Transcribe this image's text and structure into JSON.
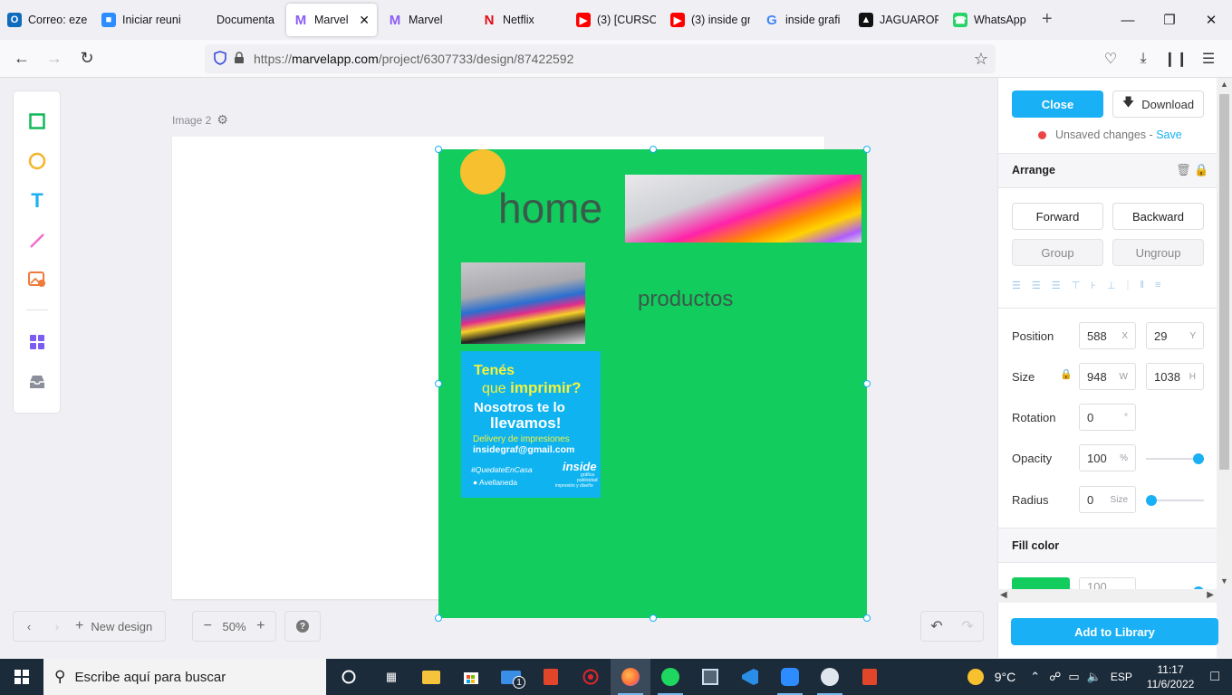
{
  "browser": {
    "tabs": [
      {
        "label": "Correo: eze",
        "icon": "outlook-icon",
        "color": "#0f6cbd"
      },
      {
        "label": "Iniciar reuni",
        "icon": "zoom-icon",
        "color": "#2d8cff"
      },
      {
        "label": "Documenta",
        "icon": "document-icon",
        "color": "#aaaaaa"
      },
      {
        "label": "Marvel",
        "icon": "marvel-icon",
        "color": "#8c5cf5",
        "active": true
      },
      {
        "label": "Marvel",
        "icon": "marvel-icon",
        "color": "#8c5cf5"
      },
      {
        "label": "Netflix",
        "icon": "netflix-icon",
        "color": "#e50914"
      },
      {
        "label": "(3) [CURSO",
        "icon": "youtube-icon",
        "color": "#ff0000"
      },
      {
        "label": "(3) inside gr",
        "icon": "youtube-icon",
        "color": "#ff0000"
      },
      {
        "label": "inside grafi",
        "icon": "google-icon",
        "color": "#4285f4"
      },
      {
        "label": "JAGUAROF",
        "icon": "jaguar-icon",
        "color": "#111111"
      },
      {
        "label": "WhatsApp",
        "icon": "whatsapp-icon",
        "color": "#25d366"
      }
    ],
    "url_prefix": "https://",
    "url_host": "marvelapp.com",
    "url_path": "/project/6307733/design/87422592"
  },
  "editor": {
    "artboard_label": "Image 2",
    "canvas": {
      "home_text": "home",
      "productos_text": "productos",
      "poster": {
        "line1": "Tenés",
        "line2a": "que",
        "line2b": "imprimir?",
        "line3": "Nosotros te lo",
        "line4": "llevamos!",
        "line5": "Delivery de impresiones",
        "line6": "insidegraf@gmail.com",
        "hashtag": "#QuedateEnCasa",
        "location": "Avellaneda",
        "brand": "inside",
        "brand_sub1": "gráfica",
        "brand_sub2": "publicidad",
        "brand_sub3": "impresión y diseño"
      }
    },
    "bottom": {
      "new_design": "New design",
      "zoom": "50%"
    }
  },
  "panel": {
    "close": "Close",
    "download": "Download",
    "unsaved": "Unsaved changes",
    "separator": " - ",
    "save": "Save",
    "arrange_title": "Arrange",
    "forward": "Forward",
    "backward": "Backward",
    "group": "Group",
    "ungroup": "Ungroup",
    "position_label": "Position",
    "pos_x": "588",
    "pos_x_unit": "X",
    "pos_y": "29",
    "pos_y_unit": "Y",
    "size_label": "Size",
    "width": "948",
    "width_unit": "W",
    "height": "1038",
    "height_unit": "H",
    "rotation_label": "Rotation",
    "rotation": "0",
    "rotation_unit": "°",
    "opacity_label": "Opacity",
    "opacity": "100",
    "opacity_unit": "%",
    "radius_label": "Radius",
    "radius": "0",
    "radius_unit": "Size",
    "fill_title": "Fill color",
    "add_library": "Add to Library",
    "accent": "#1ab0f5",
    "fill": "#12cc5e"
  },
  "taskbar": {
    "search_placeholder": "Escribe aquí para buscar",
    "temperature": "9°C",
    "lang": "ESP",
    "time": "11:17",
    "date": "11/6/2022",
    "mail_badge": "1"
  }
}
